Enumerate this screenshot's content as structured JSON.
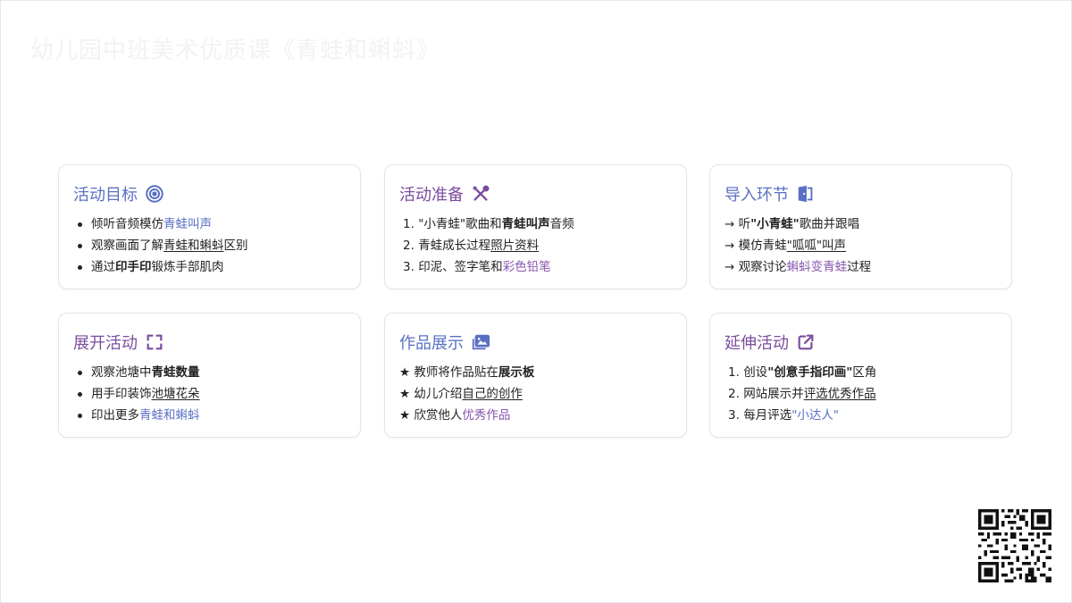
{
  "page": {
    "title": "幼儿园中班美术优质课《青蛙和蝌蚪》"
  },
  "colors": {
    "blue_accent": "#5a6fc4",
    "purple_accent": "#7b4d9e"
  },
  "cards": [
    {
      "title": "活动目标",
      "icon": "target-icon",
      "items": [
        {
          "a": "倾听音频模仿",
          "b": "青蛙叫声",
          "c": ""
        },
        {
          "a": "观察画面了解",
          "b": "青蛙和蝌蚪",
          "c": "区别"
        },
        {
          "a": "通过",
          "b": "印手印",
          "c": "锻炼手部肌肉"
        }
      ]
    },
    {
      "title": "活动准备",
      "icon": "tools-icon",
      "items": [
        {
          "n": "1.",
          "a": "\"小青蛙\"歌曲和",
          "b": "青蛙叫声",
          "c": "音频"
        },
        {
          "n": "2.",
          "a": "青蛙成长过程",
          "b": "照片资料",
          "c": ""
        },
        {
          "n": "3.",
          "a": "印泥、签字笔和",
          "b": "彩色铅笔",
          "c": ""
        }
      ]
    },
    {
      "title": "导入环节",
      "icon": "door-icon",
      "items": [
        {
          "n": "→",
          "a": "听",
          "b": "\"小青蛙\"",
          "c": "歌曲并跟唱"
        },
        {
          "n": "→",
          "a": "模仿青蛙",
          "b": "\"呱呱\"叫声",
          "c": ""
        },
        {
          "n": "→",
          "a": "观察讨论",
          "b": "蝌蚪变青蛙",
          "c": "过程"
        }
      ]
    },
    {
      "title": "展开活动",
      "icon": "expand-icon",
      "items": [
        {
          "a": "观察池塘中",
          "b": "青蛙数量",
          "c": ""
        },
        {
          "a": "用手印装饰",
          "b": "池塘花朵",
          "c": ""
        },
        {
          "a": "印出更多",
          "b": "青蛙和蝌蚪",
          "c": ""
        }
      ]
    },
    {
      "title": "作品展示",
      "icon": "gallery-icon",
      "items": [
        {
          "n": "★",
          "a": "教师将作品贴在",
          "b": "展示板",
          "c": ""
        },
        {
          "n": "★",
          "a": "幼儿介绍",
          "b": "自己的创作",
          "c": ""
        },
        {
          "n": "★",
          "a": "欣赏他人",
          "b": "优秀作品",
          "c": ""
        }
      ]
    },
    {
      "title": "延伸活动",
      "icon": "external-link-icon",
      "items": [
        {
          "n": "1.",
          "a": "创设",
          "b": "\"创意手指印画\"",
          "c": "区角"
        },
        {
          "n": "2.",
          "a": "网站展示并",
          "b": "评选优秀作品",
          "c": ""
        },
        {
          "n": "3.",
          "a": "每月评选",
          "b": "\"小达人\"",
          "c": ""
        }
      ]
    }
  ]
}
